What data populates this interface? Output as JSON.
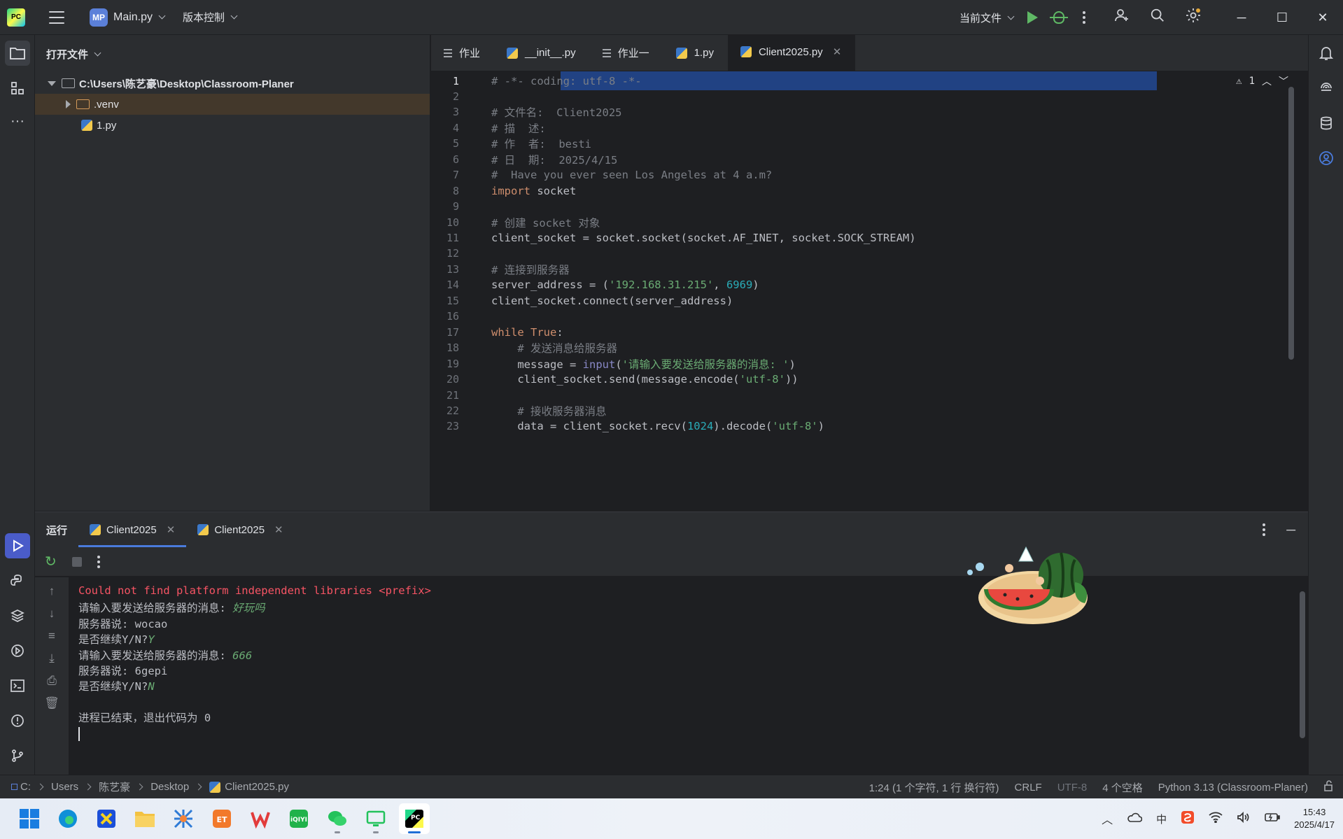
{
  "titlebar": {
    "project_badge": "MP",
    "project_name": "Main.py",
    "vcs_label": "版本控制",
    "run_config": "当前文件"
  },
  "project_panel": {
    "header": "打开文件",
    "tree": [
      {
        "label": "C:\\Users\\陈艺豪\\Desktop\\Classroom-Planer",
        "type": "root"
      },
      {
        "label": ".venv",
        "type": "folder"
      },
      {
        "label": "1.py",
        "type": "file"
      }
    ]
  },
  "editor": {
    "tabs": [
      {
        "label": "作业",
        "icon": "text-file-icon",
        "active": false
      },
      {
        "label": "__init__.py",
        "icon": "python-file-icon",
        "active": false
      },
      {
        "label": "作业一",
        "icon": "text-file-icon",
        "active": false
      },
      {
        "label": "1.py",
        "icon": "python-file-icon",
        "active": false
      },
      {
        "label": "Client2025.py",
        "icon": "python-file-icon",
        "active": true
      }
    ],
    "warning_count": "1",
    "lines": [
      "# -*- coding: utf-8 -*-",
      "",
      "# 文件名:  Client2025",
      "# 描  述:",
      "# 作  者:  besti",
      "# 日  期:  2025/4/15",
      "#  Have you ever seen Los Angeles at 4 a.m?",
      "import socket",
      "",
      "# 创建 socket 对象",
      "client_socket = socket.socket(socket.AF_INET, socket.SOCK_STREAM)",
      "",
      "# 连接到服务器",
      "server_address = ('192.168.31.215', 6969)",
      "client_socket.connect(server_address)",
      "",
      "while True:",
      "    # 发送消息给服务器",
      "    message = input('请输入要发送给服务器的消息: ')",
      "    client_socket.send(message.encode('utf-8'))",
      "",
      "    # 接收服务器消息",
      "    data = client_socket.recv(1024).decode('utf-8')"
    ]
  },
  "run_panel": {
    "title": "运行",
    "tabs": [
      "Client2025",
      "Client2025"
    ],
    "console": [
      {
        "text": "Could not find platform independent libraries <prefix>",
        "kind": "error"
      },
      {
        "prompt": "请输入要发送给服务器的消息: ",
        "input": "好玩吗"
      },
      {
        "text": "服务器说: wocao",
        "kind": "out"
      },
      {
        "prompt": "是否继续Y/N?",
        "input": "Y"
      },
      {
        "prompt": "请输入要发送给服务器的消息: ",
        "input": "666"
      },
      {
        "text": "服务器说: 6gepi",
        "kind": "out"
      },
      {
        "prompt": "是否继续Y/N?",
        "input": "N"
      },
      {
        "text": "",
        "kind": "out"
      },
      {
        "text": "进程已结束，退出代码为 0",
        "kind": "out"
      }
    ]
  },
  "statusbar": {
    "breadcrumb": [
      "C:",
      "Users",
      "陈艺豪",
      "Desktop",
      "Client2025.py"
    ],
    "position": "1:24 (1 个字符, 1 行 换行符)",
    "line_sep": "CRLF",
    "encoding": "UTF-8",
    "indent": "4 个空格",
    "interpreter": "Python 3.13 (Classroom-Planer)"
  },
  "taskbar": {
    "time": "15:43",
    "date": "2025/4/17",
    "tray_ime": "中"
  },
  "colors": {
    "accent": "#4a5cc9",
    "comment": "#7a7e85",
    "keyword": "#cf8e6d",
    "string": "#6aab73",
    "number": "#2aacb8",
    "error": "#f75464"
  }
}
